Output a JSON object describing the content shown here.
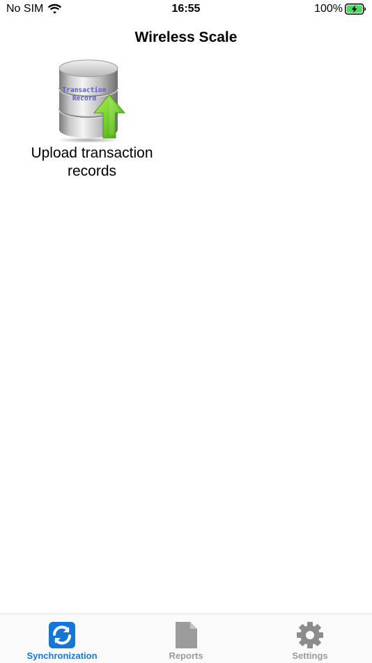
{
  "status_bar": {
    "carrier": "No SIM",
    "time": "16:55",
    "battery": "100%",
    "wifi_icon": "wifi-icon",
    "battery_icon": "battery-charging-icon"
  },
  "header": {
    "title": "Wireless Scale"
  },
  "main": {
    "tiles": [
      {
        "label": "Upload transaction records",
        "icon": "database-upload-icon",
        "icon_text_line1": "Transaction",
        "icon_text_line2": "Record"
      }
    ]
  },
  "tab_bar": {
    "active_color": "#1676d8",
    "inactive_color": "#9b9b9b",
    "tabs": [
      {
        "label": "Synchronization",
        "icon": "sync-icon",
        "active": true
      },
      {
        "label": "Reports",
        "icon": "document-icon",
        "active": false
      },
      {
        "label": "Settings",
        "icon": "gear-icon",
        "active": false
      }
    ]
  }
}
